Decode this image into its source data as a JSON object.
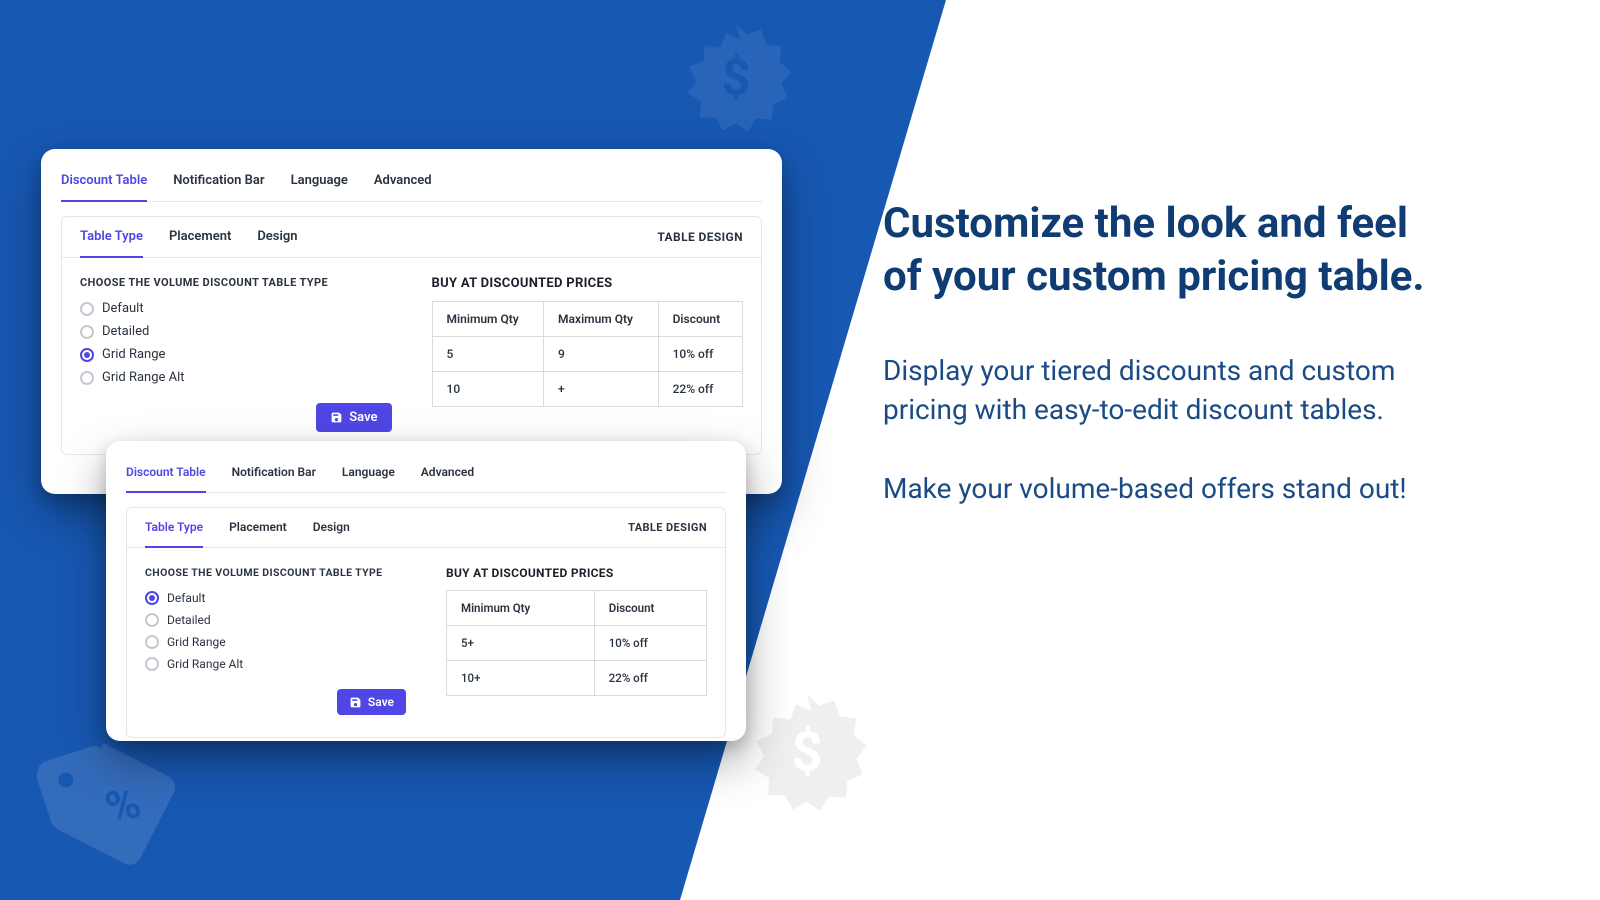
{
  "marketing": {
    "headline": "Customize the look and feel of your custom pricing table.",
    "p1": "Display your tiered discounts and custom pricing with easy-to-edit discount tables.",
    "p2": "Make your volume-based offers stand out!"
  },
  "toptabs": [
    "Discount Table",
    "Notification Bar",
    "Language",
    "Advanced"
  ],
  "subtabs": [
    "Table Type",
    "Placement",
    "Design"
  ],
  "panel_link": "TABLE DESIGN",
  "section_label": "CHOOSE THE VOLUME DISCOUNT TABLE TYPE",
  "radios": [
    "Default",
    "Detailed",
    "Grid Range",
    "Grid Range Alt"
  ],
  "save_label": "Save",
  "preview_title": "BUY AT DISCOUNTED PRICES",
  "cardA": {
    "selected_radio": 2,
    "columns": [
      "Minimum Qty",
      "Maximum Qty",
      "Discount"
    ],
    "rows": [
      {
        "c0": "5",
        "c1": "9",
        "c2": "10% off"
      },
      {
        "c0": "10",
        "c1": "+",
        "c2": "22% off"
      }
    ]
  },
  "cardB": {
    "selected_radio": 0,
    "columns": [
      "Minimum Qty",
      "Discount"
    ],
    "rows": [
      {
        "c0": "5+",
        "c1": "10% off"
      },
      {
        "c0": "10+",
        "c1": "22% off"
      }
    ]
  }
}
